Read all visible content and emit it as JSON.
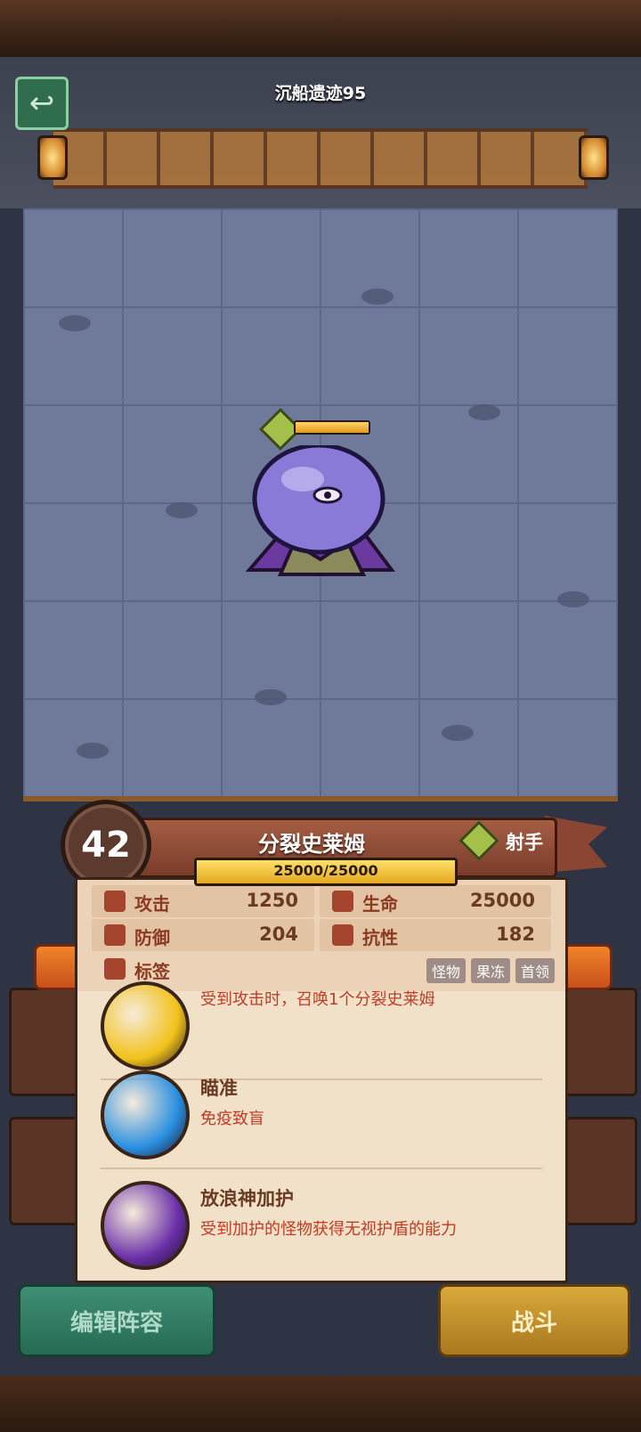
{
  "header": {
    "stage_title": "沉船遗迹95",
    "back_icon": "back-arrow-icon"
  },
  "monster": {
    "level": "42",
    "name": "分裂史莱姆",
    "role": "射手",
    "hp_text": "25000/25000",
    "hp_fraction": 1.0,
    "stats": {
      "attack_label": "攻击",
      "attack_value": "1250",
      "life_label": "生命",
      "life_value": "25000",
      "defense_label": "防御",
      "defense_value": "204",
      "resist_label": "抗性",
      "resist_value": "182"
    },
    "tags_label": "标签",
    "tags": [
      "怪物",
      "果冻",
      "首领"
    ]
  },
  "skills": [
    {
      "title": "",
      "desc": "受到攻击时，召唤1个分裂史莱姆",
      "color": "#f2c21a"
    },
    {
      "title": "瞄准",
      "desc": "免疫致盲",
      "color": "#2a8fe0"
    },
    {
      "title": "放浪神加护",
      "desc": "受到加护的怪物获得无视护盾的能力",
      "color": "#6a2fa8"
    }
  ],
  "buttons": {
    "edit": "编辑阵容",
    "fight": "战斗"
  },
  "colors": {
    "accent_green": "#2f6d4e",
    "accent_gold": "#d9a93a",
    "hp_yellow": "#ffe06a"
  }
}
